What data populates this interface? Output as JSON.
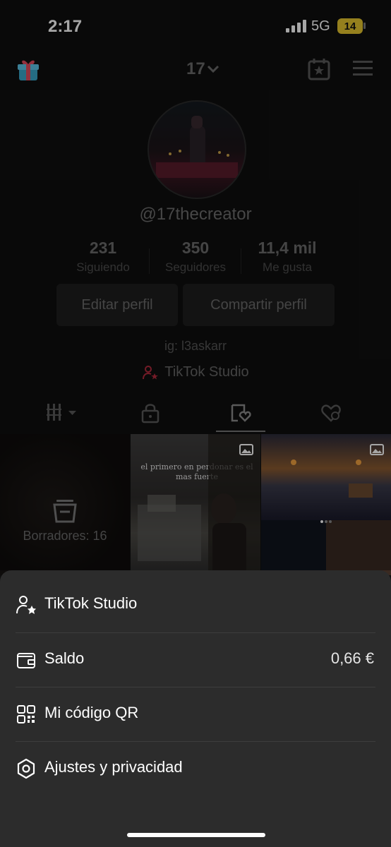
{
  "status_bar": {
    "time": "2:17",
    "network": "5G",
    "battery": "14"
  },
  "header": {
    "account_name": "17"
  },
  "profile": {
    "handle": "@17thecreator",
    "stats": [
      {
        "value": "231",
        "label": "Siguiendo"
      },
      {
        "value": "350",
        "label": "Seguidores"
      },
      {
        "value": "11,4 mil",
        "label": "Me gusta"
      }
    ],
    "buttons": {
      "edit": "Editar perfil",
      "share": "Compartir perfil"
    },
    "bio": "ig: l3askarr",
    "studio_link": "TikTok Studio"
  },
  "grid": {
    "drafts_label": "Borradores: 16",
    "quote_text": "el primero en perdonar es el mas fuerte"
  },
  "sheet": {
    "items": [
      {
        "label": "TikTok Studio",
        "icon": "person-star-icon"
      },
      {
        "label": "Saldo",
        "value": "0,66 €",
        "icon": "wallet-icon"
      },
      {
        "label": "Mi código QR",
        "icon": "qr-code-icon"
      },
      {
        "label": "Ajustes y privacidad",
        "icon": "gear-icon"
      }
    ]
  },
  "colors": {
    "sheet_bg": "#2c2c2c",
    "accent_red": "#e0304a",
    "battery": "#e5c52f"
  }
}
